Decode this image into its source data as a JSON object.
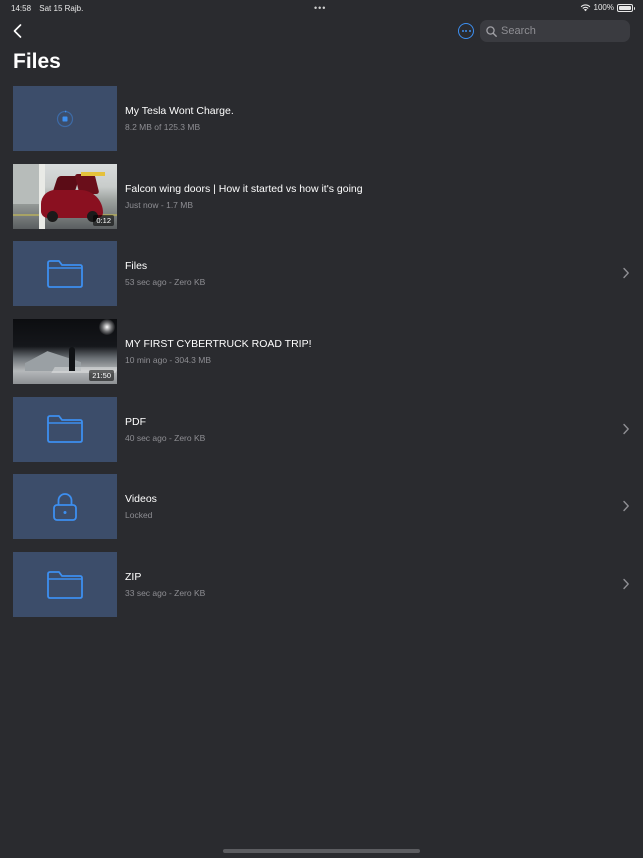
{
  "status_bar": {
    "time": "14:58",
    "date": "Sat 15 Rajb.",
    "multitask_dots": "•••",
    "battery_percent": "100%",
    "battery_level": 1.0
  },
  "nav": {
    "search_placeholder": "Search"
  },
  "page": {
    "title": "Files"
  },
  "colors": {
    "background": "#2a2b2f",
    "accent": "#3d8ff0",
    "thumb_bg": "#3c4d6a",
    "secondary_text": "#8e8e93"
  },
  "items": [
    {
      "kind": "download",
      "icon": "stop-download-icon",
      "title": "My Tesla Wont Charge.",
      "subtitle": "8.2 MB of 125.3 MB",
      "chevron": false
    },
    {
      "kind": "video-car",
      "title": "Falcon wing doors | How it started vs how it's going",
      "subtitle": "Just now - 1.7 MB",
      "duration": "0:12",
      "chevron": false
    },
    {
      "kind": "folder",
      "icon": "folder-icon",
      "title": "Files",
      "subtitle": "53 sec ago - Zero KB",
      "chevron": true
    },
    {
      "kind": "video-truck",
      "title": "MY FIRST CYBERTRUCK ROAD TRIP!",
      "subtitle": "10 min ago - 304.3 MB",
      "duration": "21:50",
      "chevron": false
    },
    {
      "kind": "folder",
      "icon": "folder-icon",
      "title": "PDF",
      "subtitle": "40 sec ago - Zero KB",
      "chevron": true
    },
    {
      "kind": "locked-folder",
      "icon": "lock-icon",
      "title": "Videos",
      "subtitle": "Locked",
      "chevron": true
    },
    {
      "kind": "folder",
      "icon": "folder-icon",
      "title": "ZIP",
      "subtitle": "33 sec ago - Zero KB",
      "chevron": true
    }
  ]
}
